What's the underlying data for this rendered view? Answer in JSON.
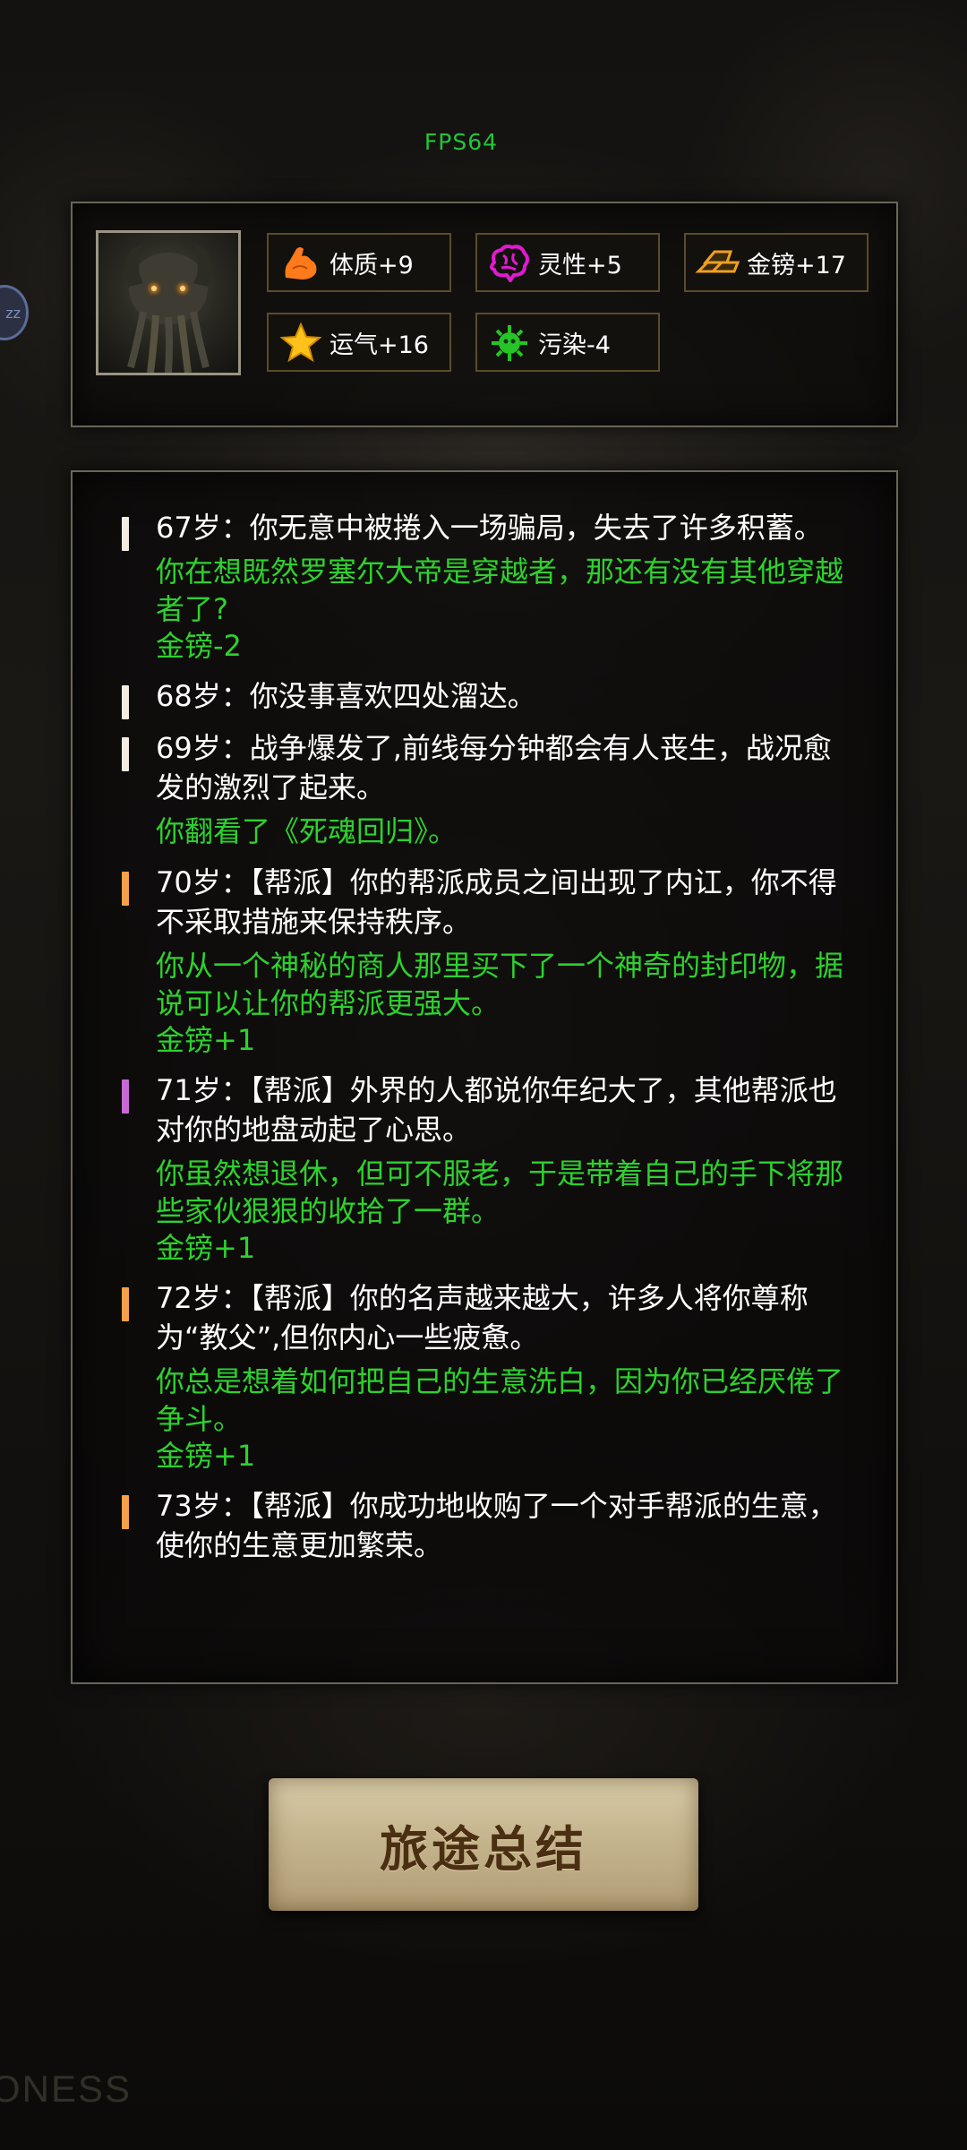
{
  "fps": "FPS64",
  "side_badge": "zz",
  "stats": [
    {
      "icon": "muscle-arm-icon",
      "label": "体质+9",
      "color": "#ff7a1a"
    },
    {
      "icon": "brain-icon",
      "label": "灵性+5",
      "color": "#e01ad0"
    },
    {
      "icon": "gold-bars-icon",
      "label": "金镑+17",
      "color": "#f0a020"
    },
    {
      "icon": "star-icon",
      "label": "运气+16",
      "color": "#ffc21a"
    },
    {
      "icon": "virus-icon",
      "label": "污染-4",
      "color": "#27c427"
    }
  ],
  "entries": [
    {
      "bar_color": "#f3ece0",
      "main": "67岁：你无意中被捲入一场骗局，失去了许多积蓄。",
      "sub": "你在想既然罗塞尔大帝是穿越者，那还有没有其他穿越者了?",
      "gold": "金镑-2"
    },
    {
      "bar_color": "#f3ece0",
      "main": "68岁：你没事喜欢四处溜达。"
    },
    {
      "bar_color": "#f3ece0",
      "main": "69岁：战争爆发了,前线每分钟都会有人丧生，战况愈发的激烈了起来。",
      "sub": "你翻看了《死魂回归》。"
    },
    {
      "bar_color": "#f5a04a",
      "main": "70岁：【帮派】你的帮派成员之间出现了内讧，你不得不采取措施来保持秩序。",
      "sub": "你从一个神秘的商人那里买下了一个神奇的封印物，据说可以让你的帮派更强大。",
      "gold": "金镑+1"
    },
    {
      "bar_color": "#c86ad6",
      "main": "71岁：【帮派】外界的人都说你年纪大了，其他帮派也对你的地盘动起了心思。",
      "sub": "你虽然想退休，但可不服老，于是带着自己的手下将那些家伙狠狠的收拾了一群。",
      "gold": "金镑+1"
    },
    {
      "bar_color": "#f5a04a",
      "main": "72岁：【帮派】你的名声越来越大，许多人将你尊称为“教父”,但你内心一些疲惫。",
      "sub": "你总是想着如何把自己的生意洗白，因为你已经厌倦了争斗。",
      "gold": "金镑+1"
    },
    {
      "bar_color": "#f5a04a",
      "main": "73岁：【帮派】你成功地收购了一个对手帮派的生意，使你的生意更加繁荣。"
    }
  ],
  "summary_button": "旅途总结",
  "watermark": "ONESS"
}
